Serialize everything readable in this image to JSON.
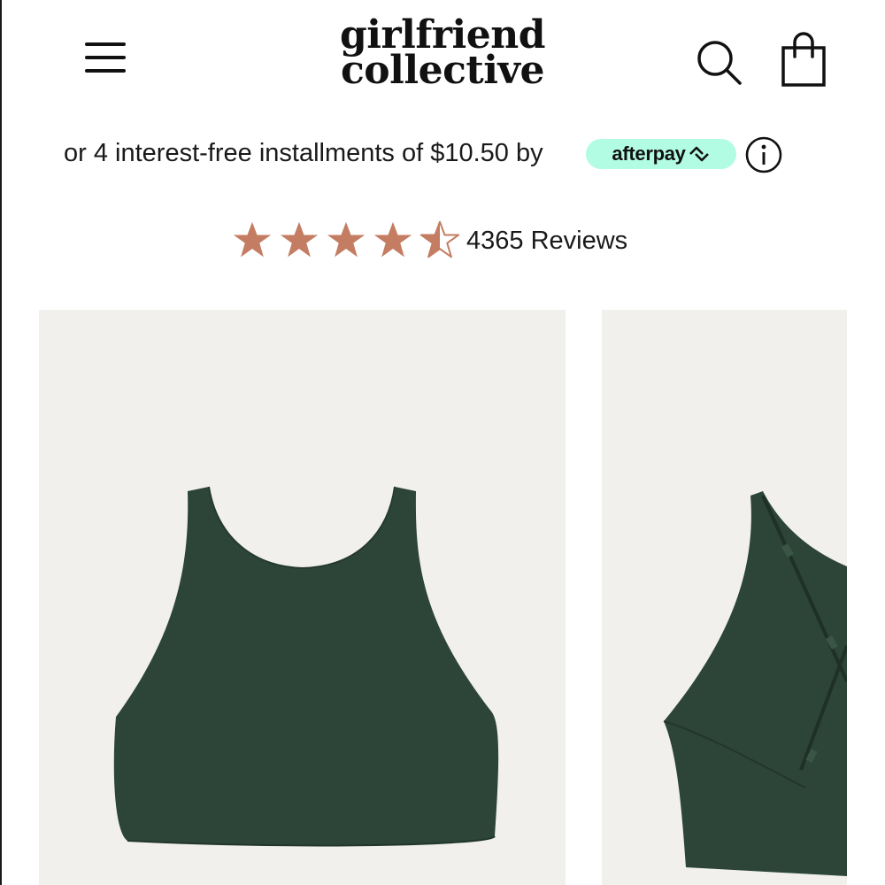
{
  "header": {
    "brand_line_1": "girlfriend",
    "brand_line_2": "collective",
    "menu_icon": "hamburger-menu-icon",
    "search_icon": "search-icon",
    "bag_icon": "shopping-bag-icon"
  },
  "afterpay": {
    "text": "or 4 interest-free installments of $10.50 by",
    "badge_label": "afterpay",
    "badge_icon": "afterpay-arrows-icon",
    "info_icon": "info-icon",
    "badge_color": "#b2fce4"
  },
  "rating": {
    "stars": 4.5,
    "max_stars": 5,
    "star_color": "#c47d63",
    "reviews_label": "4365 Reviews"
  },
  "gallery": {
    "images": [
      {
        "name": "product-image-front",
        "product_color": "#2c4538",
        "background": "#f2f0ed"
      },
      {
        "name": "product-image-back",
        "product_color": "#2c4538",
        "background": "#f2f0ed"
      }
    ]
  }
}
